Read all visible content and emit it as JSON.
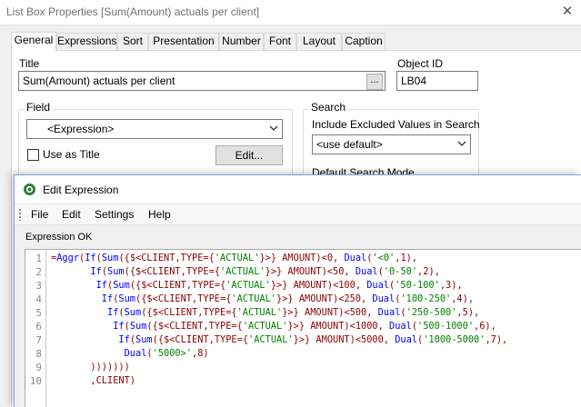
{
  "list_box_properties": {
    "window_title": "List Box Properties [Sum(Amount) actuals per client]",
    "tabs": [
      {
        "label": "General",
        "active": true
      },
      {
        "label": "Expressions"
      },
      {
        "label": "Sort"
      },
      {
        "label": "Presentation"
      },
      {
        "label": "Number"
      },
      {
        "label": "Font"
      },
      {
        "label": "Layout"
      },
      {
        "label": "Caption"
      }
    ],
    "title_label": "Title",
    "title_value": "Sum(Amount) actuals per client",
    "browse_label": "...",
    "object_id_label": "Object ID",
    "object_id_value": "LB04",
    "field_group_label": "Field",
    "field_value": "<Expression>",
    "use_as_title_label": "Use as Title",
    "use_as_title_checked": false,
    "edit_button_label": "Edit...",
    "search_group_label": "Search",
    "include_excluded_label": "Include Excluded Values in Search",
    "include_excluded_value": "<use default>",
    "default_search_mode_label": "Default Search Mode"
  },
  "edit_expression": {
    "window_title": "Edit Expression",
    "menu": [
      "File",
      "Edit",
      "Settings",
      "Help"
    ],
    "status": "Expression OK",
    "line_numbers": [
      "1",
      "2",
      "3",
      "4",
      "5",
      "6",
      "7",
      "8",
      "9",
      "10"
    ],
    "code": [
      "=Aggr(If(Sum({$<CLIENT,TYPE={'ACTUAL'}>} AMOUNT)<0, Dual('<0',1),",
      "       If(Sum({$<CLIENT,TYPE={'ACTUAL'}>} AMOUNT)<50, Dual('0-50',2),",
      "        If(Sum({$<CLIENT,TYPE={'ACTUAL'}>} AMOUNT)<100, Dual('50-100',3),",
      "         If(Sum({$<CLIENT,TYPE={'ACTUAL'}>} AMOUNT)<250, Dual('100-250',4),",
      "          If(Sum({$<CLIENT,TYPE={'ACTUAL'}>} AMOUNT)<500, Dual('250-500',5),",
      "           If(Sum({$<CLIENT,TYPE={'ACTUAL'}>} AMOUNT)<1000, Dual('500-1000',6),",
      "            If(Sum({$<CLIENT,TYPE={'ACTUAL'}>} AMOUNT)<5000, Dual('1000-5000',7),",
      "             Dual('5000>',8)",
      "       )))))))",
      "       ,CLIENT)"
    ]
  },
  "colors": {
    "keyword": "#0000ff",
    "string": "#008000",
    "default_code": "#8b0000",
    "icon": "#2e7d32"
  },
  "icons": {
    "window_icon": "qlikview-icon",
    "dropdown": "chevron-down-icon",
    "menu_grip": "toolbar-grip-icon",
    "close": "close-icon"
  }
}
